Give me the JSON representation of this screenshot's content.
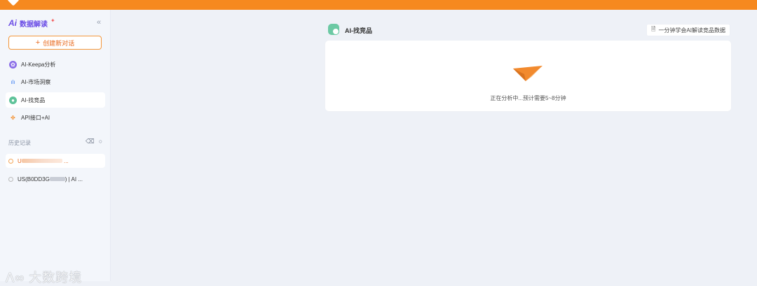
{
  "brand": {
    "logo": "Ai",
    "name": "数据解读"
  },
  "sidebar": {
    "new_chat_label": "创建新对话",
    "items": [
      {
        "label": "AI-Keepa分析",
        "icon": "keepa-icon"
      },
      {
        "label": "AI-市场洞察",
        "icon": "bar-chart-icon"
      },
      {
        "label": "AI-找竞品",
        "icon": "find-competitor-icon",
        "active": true
      },
      {
        "label": "API接口+AI",
        "icon": "api-icon"
      }
    ],
    "history_title": "历史记录",
    "history": [
      {
        "label_prefix": "U",
        "label_suffix": "...",
        "active": true
      },
      {
        "label_prefix": "US(B0DD3G",
        "label_suffix": ") | AI ..."
      }
    ]
  },
  "main": {
    "title": "AI-找竞品",
    "help_label": "一分钟学会AI解读竞品数据",
    "status": "正在分析中...预计需要5~8分钟"
  },
  "watermark": "大数跨境",
  "colors": {
    "accent": "#f6891f",
    "brand": "#6b4de6"
  }
}
